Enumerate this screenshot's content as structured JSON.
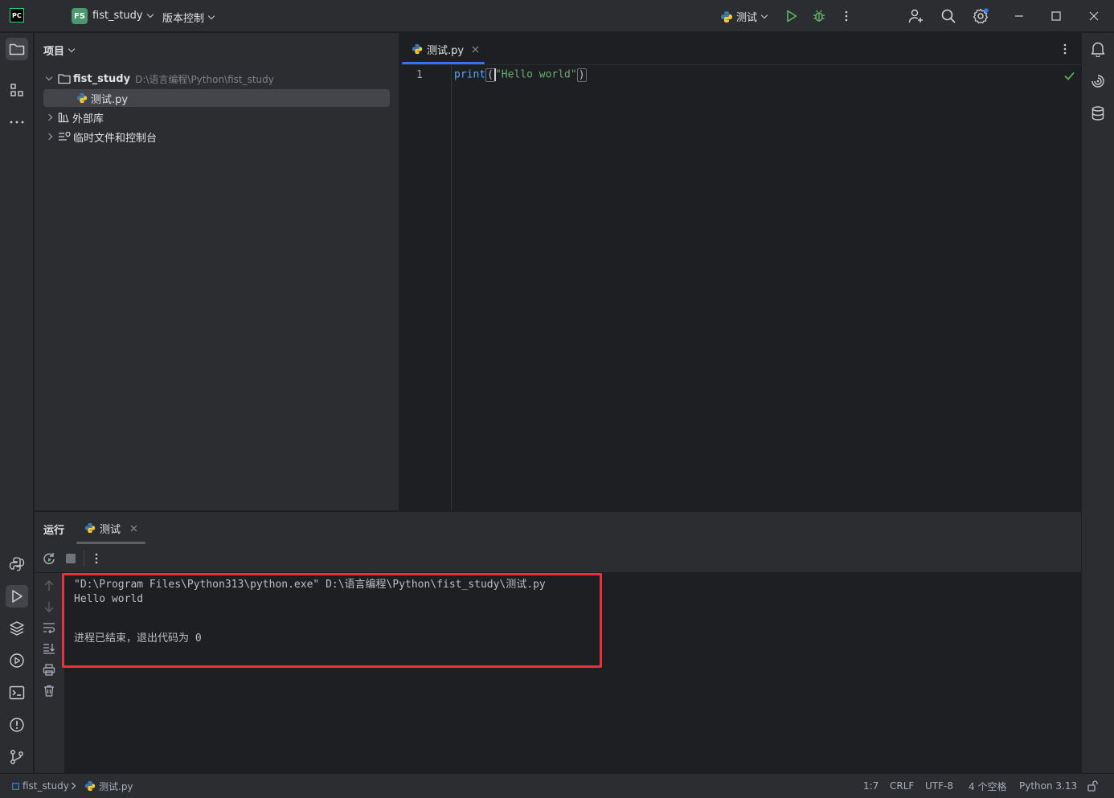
{
  "titlebar": {
    "app_logo": "PC",
    "project_badge": "FS",
    "project_name": "fist_study",
    "vcs_label": "版本控制",
    "run_config": "测试"
  },
  "left_strip": {
    "icons": [
      "folder-icon",
      "structure-icon",
      "more-icon",
      "python-console-icon",
      "run-icon",
      "layers-icon",
      "services-icon",
      "terminal-icon",
      "problems-icon",
      "git-icon"
    ]
  },
  "project_panel": {
    "header": "项目",
    "tree": [
      {
        "label": "fist_study",
        "hint": "D:\\语言编程\\Python\\fist_study"
      },
      {
        "label": "测试.py"
      },
      {
        "label": "外部库"
      },
      {
        "label": "临时文件和控制台"
      }
    ]
  },
  "editor": {
    "tab_label": "测试.py",
    "line_number": "1",
    "code": {
      "func": "print",
      "open_paren": "(",
      "string": "\"Hello world\"",
      "close_paren": ")"
    }
  },
  "run_panel": {
    "title": "运行",
    "tab_label": "测试",
    "console": [
      "\"D:\\Program Files\\Python313\\python.exe\" D:\\语言编程\\Python\\fist_study\\测试.py",
      "Hello world",
      "",
      "进程已结束，退出代码为 0"
    ]
  },
  "statusbar": {
    "breadcrumb_project": "fist_study",
    "breadcrumb_file": "测试.py",
    "position": "1:7",
    "line_separator": "CRLF",
    "encoding": "UTF-8",
    "indent": "4 个空格",
    "interpreter": "Python 3.13"
  },
  "colors": {
    "accent": "#3574f0",
    "run_green": "#5fb865",
    "highlight_red": "#e5323e"
  }
}
